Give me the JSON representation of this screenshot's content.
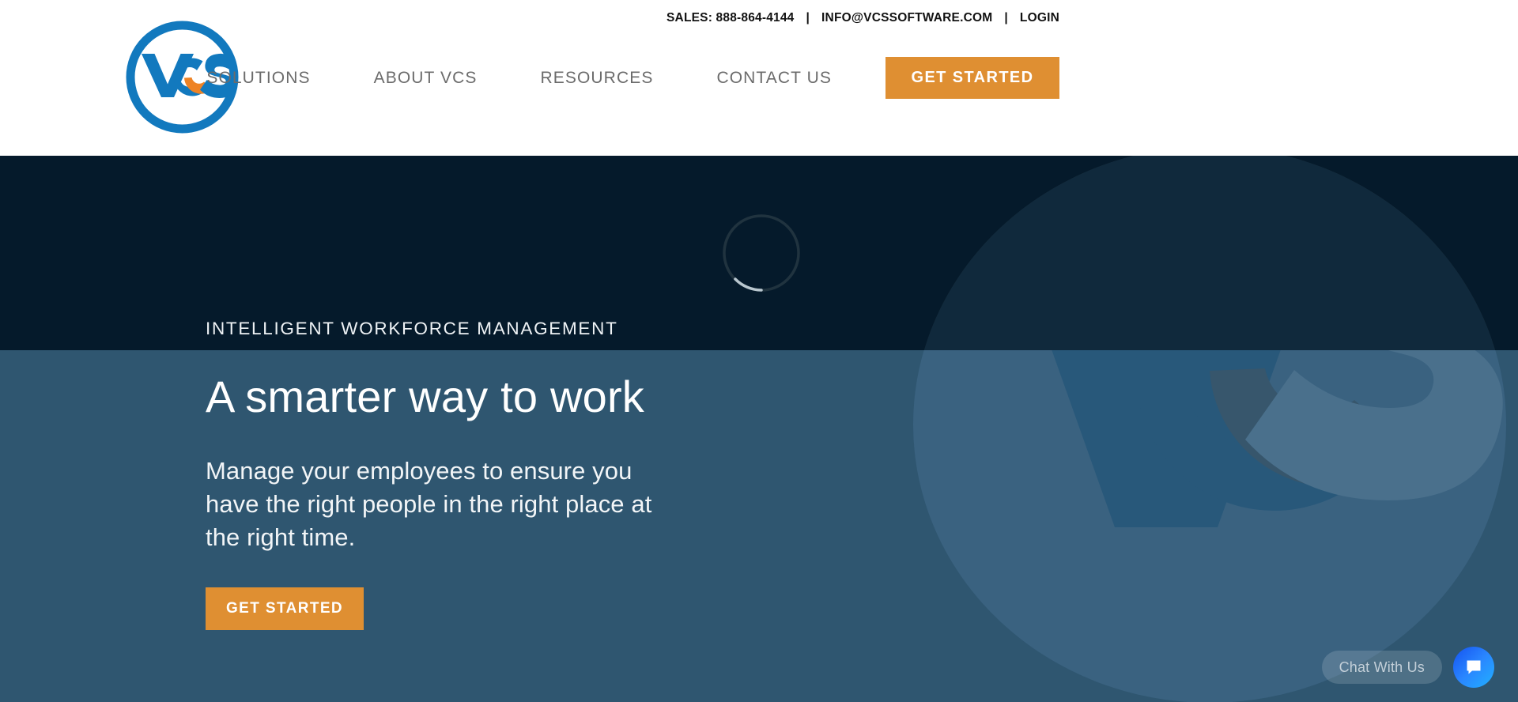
{
  "brand": {
    "name": "VCS",
    "logo_alt": "VCS circular logo",
    "logo_blue": "#1279be",
    "logo_orange": "#ee8325"
  },
  "colors": {
    "orange_cta": "#df8f32",
    "dark_navy": "#051a2b",
    "hero_blue": "#2f5670",
    "nav_text": "#6b6b6b",
    "chat_blue": "#2a86ff"
  },
  "utility": {
    "sales_label": "SALES: 888-864-4144",
    "separator": "|",
    "email": "INFO@VCSSOFTWARE.COM",
    "login": "LOGIN"
  },
  "nav": {
    "items": [
      {
        "label": "SOLUTIONS"
      },
      {
        "label": "ABOUT VCS"
      },
      {
        "label": "RESOURCES"
      },
      {
        "label": "CONTACT US"
      }
    ],
    "cta_label": "GET STARTED"
  },
  "hero": {
    "eyebrow": "INTELLIGENT WORKFORCE MANAGEMENT",
    "title": "A smarter way to work",
    "paragraph": "Manage your employees to ensure you have the right people in the right place at the right time.",
    "cta_label": "GET STARTED",
    "watermark_text": "VCS"
  },
  "loader": {
    "state": "loading",
    "icon": "spinner-icon"
  },
  "chat": {
    "pill_label": "Chat With Us",
    "button_icon": "chat-bubble-icon"
  }
}
